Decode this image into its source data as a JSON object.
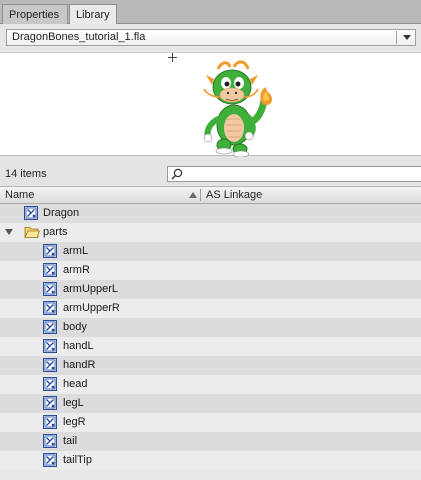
{
  "tabs": [
    {
      "label": "Properties",
      "active": false
    },
    {
      "label": "Library",
      "active": true
    }
  ],
  "document_select": {
    "value": "DragonBones_tutorial_1.fla"
  },
  "preview": {
    "image": "dragon-character-preview"
  },
  "status": {
    "item_count": "14 items"
  },
  "search": {
    "placeholder": "",
    "icon": "search-icon"
  },
  "columns": {
    "name": "Name",
    "linkage": "AS Linkage"
  },
  "items": [
    {
      "label": "Dragon",
      "icon": "movieclip-symbol-icon",
      "indent": 0
    },
    {
      "label": "parts",
      "icon": "folder-open-icon",
      "indent": 0,
      "expanded": true
    },
    {
      "label": "armL",
      "icon": "movieclip-symbol-icon",
      "indent": 1
    },
    {
      "label": "armR",
      "icon": "movieclip-symbol-icon",
      "indent": 1
    },
    {
      "label": "armUpperL",
      "icon": "movieclip-symbol-icon",
      "indent": 1
    },
    {
      "label": "armUpperR",
      "icon": "movieclip-symbol-icon",
      "indent": 1
    },
    {
      "label": "body",
      "icon": "movieclip-symbol-icon",
      "indent": 1
    },
    {
      "label": "handL",
      "icon": "movieclip-symbol-icon",
      "indent": 1
    },
    {
      "label": "handR",
      "icon": "movieclip-symbol-icon",
      "indent": 1
    },
    {
      "label": "head",
      "icon": "movieclip-symbol-icon",
      "indent": 1
    },
    {
      "label": "legL",
      "icon": "movieclip-symbol-icon",
      "indent": 1
    },
    {
      "label": "legR",
      "icon": "movieclip-symbol-icon",
      "indent": 1
    },
    {
      "label": "tail",
      "icon": "movieclip-symbol-icon",
      "indent": 1
    },
    {
      "label": "tailTip",
      "icon": "movieclip-symbol-icon",
      "indent": 1
    }
  ],
  "colors": {
    "symbol_icon_blue": "#2b4f9e",
    "folder_yellow": "#f2d36b",
    "dragon_green": "#3fae3a"
  }
}
